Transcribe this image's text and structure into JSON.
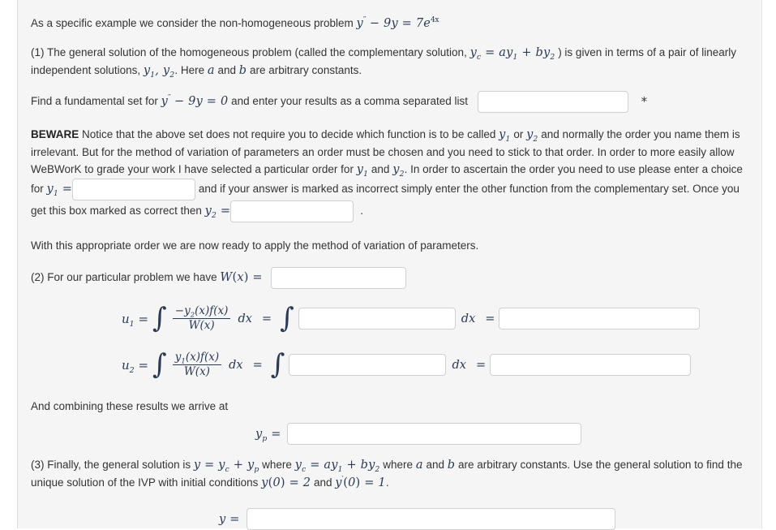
{
  "intro": {
    "text_before": "As a specific example we consider the non-homogeneous problem",
    "equation": "y'' − 9y = 7e^{4x}"
  },
  "part1": {
    "label": "(1)",
    "line1_a": "The general solution of the homogeneous problem (called the complementary solution,",
    "formula_yc": "y_c = a y_1 + b y_2",
    "line1_b": ") is given in terms of a pair of",
    "line2_a": "linearly independent solutions,",
    "symbols": "y_1, y_2",
    "line2_b": ". Here",
    "const_a": "a",
    "line2_c": "and",
    "const_b": "b",
    "line2_d": "are arbitrary constants.",
    "fundamental_prompt_a": "Find a fundamental set for",
    "fundamental_equation": "y'' − 9y = 0",
    "fundamental_prompt_b": "and enter your results as a comma separated list",
    "fundamental_input_value": "",
    "required_marker": "*"
  },
  "beware": {
    "heading": "BEWARE",
    "t1": "Notice that the above set does not require you to decide which function is to be called",
    "y1": "y_1",
    "t2": "or",
    "y2": "y_2",
    "t3": "and normally the order you name them is irrelevant. But for the method of variation of parameters an order must be chosen and you need to stick to that order. In order to more easily allow WeBWorK to grade your work I have selected a particular order for",
    "t4": "and",
    "t5": ". In order to ascertain the order you need to use please enter a choice for",
    "y1_input_value": "",
    "t6": "and if your answer is marked as incorrect simply enter the other function from the complementary set. Once you get this box marked as correct then",
    "y2_input_value": "",
    "t7": "."
  },
  "transition": "With this appropriate order we are now ready to apply the method of variation of parameters.",
  "part2": {
    "label": "(2)",
    "prompt": "For our particular problem we have",
    "symbol_W": "W(x) =",
    "w_input_value": "",
    "u1": {
      "lhs": "u_1 =",
      "numerator": "−y_2(x) f(x)",
      "denominator": "W(x)",
      "dx": "dx",
      "equals": "=",
      "integral_input_value": "",
      "dx2": "dx",
      "equals2": "=",
      "result_input_value": ""
    },
    "u2": {
      "lhs": "u_2 =",
      "numerator": "y_1(x) f(x)",
      "denominator": "W(x)",
      "dx": "dx",
      "equals": "=",
      "integral_input_value": "",
      "dx2": "dx",
      "equals2": "=",
      "result_input_value": ""
    }
  },
  "combining": {
    "text": "And combining these results we arrive at",
    "yp_label": "y_p =",
    "yp_input_value": ""
  },
  "part3": {
    "label": "(3)",
    "t1": "Finally, the general solution is",
    "eq_general": "y = y_c + y_p",
    "t2": "where",
    "eq_yc": "y_c = a y_1 + b y_2",
    "t3": "where",
    "const_a": "a",
    "t4": "and",
    "const_b": "b",
    "t5": "are arbitrary constants. Use the general solution to find the unique solution of the IVP with initial conditions",
    "ic1": "y(0) = 2",
    "t6": "and",
    "ic2": "y'(0) = 1",
    "t7": ".",
    "final_label": "y =",
    "final_input_value": ""
  }
}
